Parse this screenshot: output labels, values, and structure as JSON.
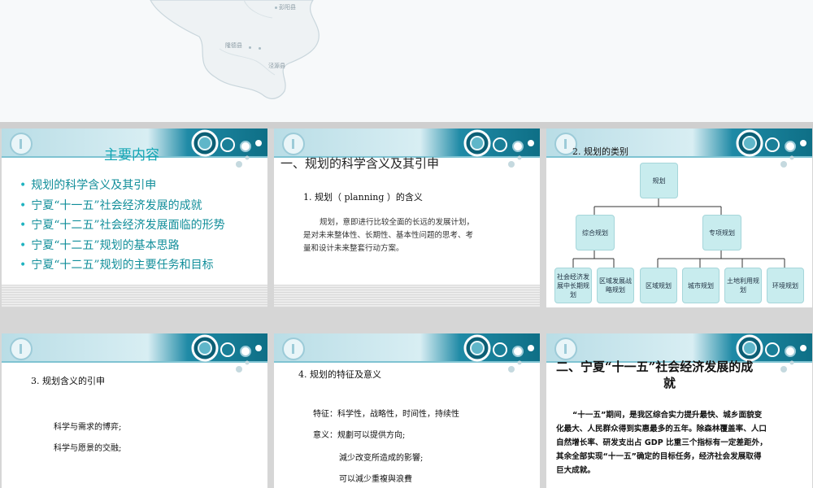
{
  "map": {
    "labels": [
      "彭阳县",
      "隆德县",
      "泾源县"
    ]
  },
  "slide1": {
    "title": "主要内容",
    "items": [
      "规划的科学含义及其引申",
      "宁夏“十一五”社会经济发展的成就",
      "宁夏“十二五”社会经济发展面临的形势",
      "宁夏“十二五”规划的基本思路",
      "宁夏“十二五”规划的主要任务和目标"
    ]
  },
  "slide2": {
    "title": "一、规划的科学含义及其引申",
    "subtitle": "1. 规划（ planning ）的含义",
    "body": [
      "规划，意即进行比较全面的长远的发展计划，",
      "是对未来整体性、长期性、基本性问题的思考、考",
      "量和设计未来整套行动方案。"
    ]
  },
  "slide3": {
    "title": "2. 规划的类别",
    "root": "规划",
    "level2": [
      "综合规划",
      "专项规划"
    ],
    "level3": [
      "社会经济发展中长期规划",
      "区域发展战略规划",
      "区域规划",
      "城市规划",
      "土地利用规划",
      "环境规划"
    ]
  },
  "slide4": {
    "title": "3. 规划含义的引申",
    "lines": [
      "科学与需求的博弈;",
      "科学与愿景的交融;"
    ]
  },
  "slide5": {
    "title": "4. 规划的特征及意义",
    "feature": "特征：科学性，战略性，时间性，持续性",
    "meaning": "意义：规劃可以提供方向;",
    "sub1": "減少改变所造成的影響;",
    "sub2": "可以減少重複與浪費"
  },
  "slide6": {
    "title_line1": "二、宁夏“十一五”社会经济发展的成",
    "title_line2": "就",
    "body": [
      "“十一五”期间，是我区综合实力提升最快、城乡面貌变",
      "化最大、人民群众得到实惠最多的五年。除森林覆盖率、人口",
      "自然增长率、研发支出占 GDP 比重三个指标有一定差距外，",
      "其余全部实现“十一五”确定的目标任务，经济社会发展取得",
      "巨大成就。"
    ]
  },
  "colors": {
    "accent": "#14a6b4",
    "header_dark": "#0e6f86",
    "node_fill": "#c8ecee"
  }
}
